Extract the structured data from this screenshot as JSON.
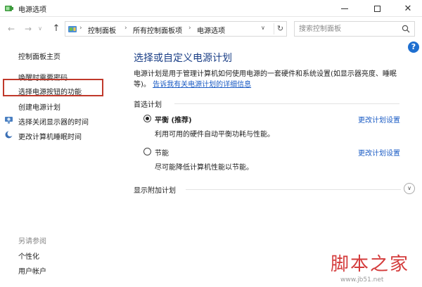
{
  "window": {
    "title": "电源选项",
    "minimize_glyph": "—",
    "maximize_glyph": "□",
    "close_glyph": "✕"
  },
  "nav": {
    "back_glyph": "←",
    "forward_glyph": "→",
    "history_glyph": "∨",
    "up_glyph": "↑",
    "breadcrumbs": [
      "控制面板",
      "所有控制面板项",
      "电源选项"
    ],
    "separator_glyph": "›",
    "dropdown_glyph": "∨",
    "refresh_glyph": "↻",
    "search_placeholder": "搜索控制面板"
  },
  "sidebar": {
    "home": "控制面板主页",
    "links": [
      "唤醒时需要密码",
      "选择电源按钮的功能",
      "创建电源计划",
      "选择关闭显示器的时间",
      "更改计算机睡眠时间"
    ],
    "see_also_title": "另请参阅",
    "see_also": [
      "个性化",
      "用户帐户"
    ]
  },
  "main": {
    "help_glyph": "?",
    "title": "选择或自定义电源计划",
    "description": "电源计划是用于管理计算机如何使用电源的一套硬件和系统设置(如显示器亮度、睡眠等)。",
    "description_link": "告诉我有关电源计划的详细信息",
    "preferred_label": "首选计划",
    "plans": [
      {
        "name": "平衡 (推荐)",
        "desc": "利用可用的硬件自动平衡功耗与性能。",
        "link": "更改计划设置",
        "selected": true
      },
      {
        "name": "节能",
        "desc": "尽可能降低计算机性能以节能。",
        "link": "更改计划设置",
        "selected": false
      }
    ],
    "extra_label": "显示附加计划",
    "expand_glyph": "∨"
  },
  "watermark": {
    "text": "脚本之家",
    "url": "www.jb51.net"
  },
  "colors": {
    "accent": "#1a5bc4",
    "title_blue": "#1a3e86",
    "highlight": "#c0392b"
  }
}
